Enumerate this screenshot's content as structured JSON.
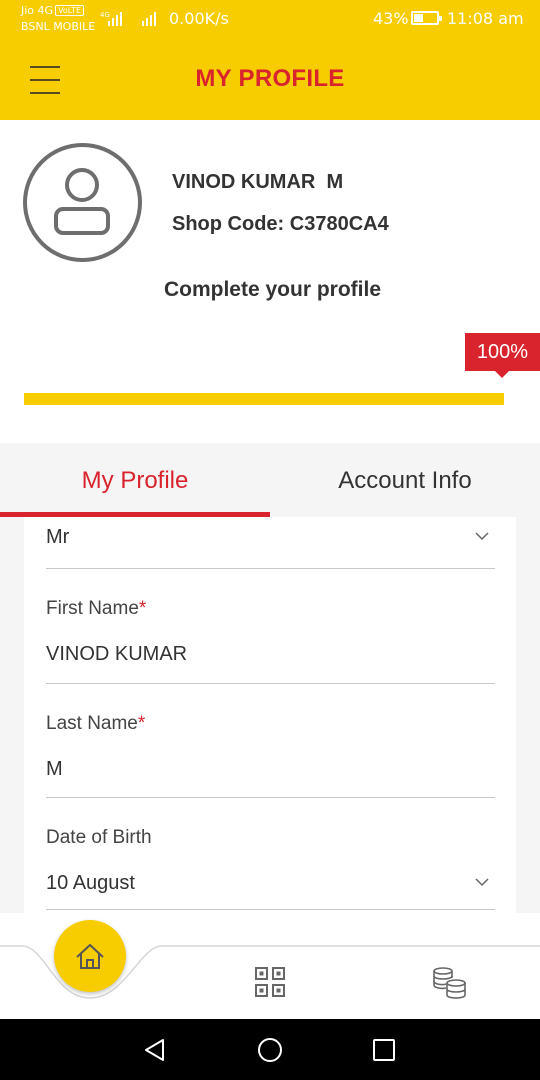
{
  "status_bar": {
    "carrier_1": "Jio 4G",
    "volte": "VoLTE",
    "carrier_2": "BSNL MOBILE",
    "net_type": "4G",
    "data_speed": "0.00K/s",
    "battery_percent": "43%",
    "battery_level": 0.43,
    "time": "11:08 am"
  },
  "header": {
    "title": "MY PROFILE",
    "menu_icon": "hamburger-menu-icon"
  },
  "profile": {
    "avatar_icon": "user-avatar-icon",
    "name": "VINOD KUMAR  M",
    "shop_code": "Shop Code: C3780CA4",
    "complete_title": "Complete your profile",
    "progress_label": "100%",
    "progress_value": 1.0
  },
  "tabs": [
    {
      "label": "My Profile",
      "active": true
    },
    {
      "label": "Account Info",
      "active": false
    }
  ],
  "form": {
    "title_value": "Mr",
    "first_name_label": "First Name",
    "first_name_value": "VINOD KUMAR",
    "last_name_label": "Last Name",
    "last_name_value": "M",
    "required_mark": "*",
    "dob_label": "Date of Birth",
    "dob_value": "10 August"
  },
  "bottom_nav": {
    "items": [
      "home-icon",
      "qr-code-icon",
      "coins-icon"
    ]
  },
  "colors": {
    "brand_yellow": "#f8cd00",
    "brand_red": "#d9232d",
    "text_dark": "#333333"
  }
}
